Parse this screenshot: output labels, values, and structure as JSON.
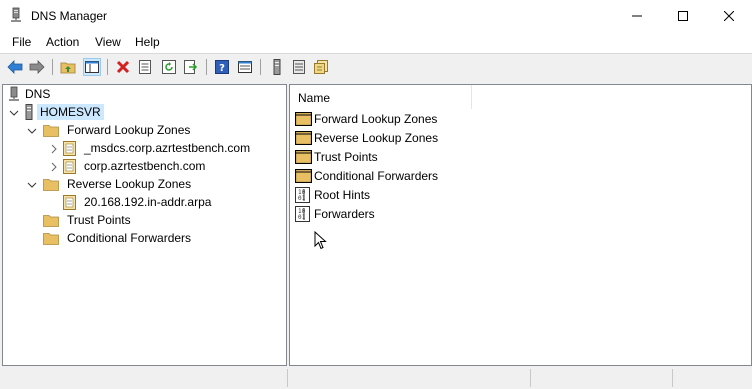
{
  "window": {
    "title": "DNS Manager"
  },
  "menu": [
    "File",
    "Action",
    "View",
    "Help"
  ],
  "tree": {
    "root": "DNS",
    "server": "HOMESVR",
    "forward_zones": "Forward Lookup Zones",
    "fz_items": [
      "_msdcs.corp.azrtestbench.com",
      "corp.azrtestbench.com"
    ],
    "reverse_zones": "Reverse Lookup Zones",
    "rz_items": [
      "20.168.192.in-addr.arpa"
    ],
    "trust_points": "Trust Points",
    "conditional_forwarders": "Conditional Forwarders"
  },
  "list": {
    "column_name": "Name",
    "items": [
      "Forward Lookup Zones",
      "Reverse Lookup Zones",
      "Trust Points",
      "Conditional Forwarders",
      "Root Hints",
      "Forwarders"
    ]
  },
  "colors": {
    "selection": "#cce8ff",
    "folder": "#dcb67a",
    "accent": "#0078d7"
  }
}
